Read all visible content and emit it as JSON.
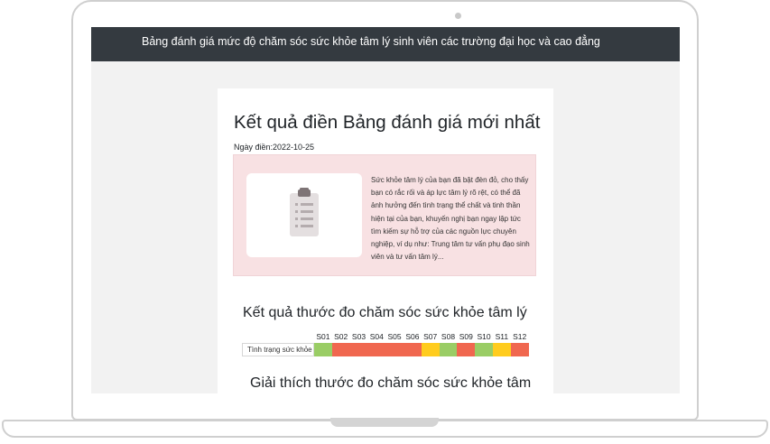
{
  "header": {
    "title": "Bảng đánh giá mức độ chăm sóc sức khỏe tâm lý sinh viên các trường đại học và cao đẳng"
  },
  "result": {
    "title": "Kết quả điền Bảng đánh giá mới nhất",
    "date_label": "Ngày điền:",
    "date_value": "2022-10-25",
    "date_line": "Ngày điền:2022-10-25",
    "advice_text": "Sức khỏe tâm lý của bạn đã bật đèn đỏ, cho thấy bạn có rắc rối và áp lực tâm lý rõ rệt, có thể đã ảnh hưởng đến tình trạng thể chất và tinh thần hiện tại của bạn, khuyến nghị bạn ngay lập tức tìm kiếm sự hỗ trợ của các nguồn lực chuyên nghiệp, ví dụ như: Trung tâm tư vấn phụ đạo sinh viên và tư vấn tâm lý...",
    "thumbnail_icon": "clipboard-icon"
  },
  "scale": {
    "title": "Kết quả thước đo chăm sóc sức khỏe tâm lý",
    "row_label": "Tình trạng sức khỏe",
    "columns": [
      "S01",
      "S02",
      "S03",
      "S04",
      "S05",
      "S06",
      "S07",
      "S08",
      "S09",
      "S10",
      "S11",
      "S12"
    ],
    "statuses": [
      "green",
      "red",
      "red",
      "red",
      "red",
      "red",
      "yellow",
      "green",
      "red",
      "green",
      "yellow",
      "red"
    ],
    "colors": {
      "green": "#9acd65",
      "red": "#f0674f",
      "yellow": "#ffcc1e"
    }
  },
  "explanation": {
    "title": "Giải thích thước đo chăm sóc sức khỏe tâm"
  }
}
